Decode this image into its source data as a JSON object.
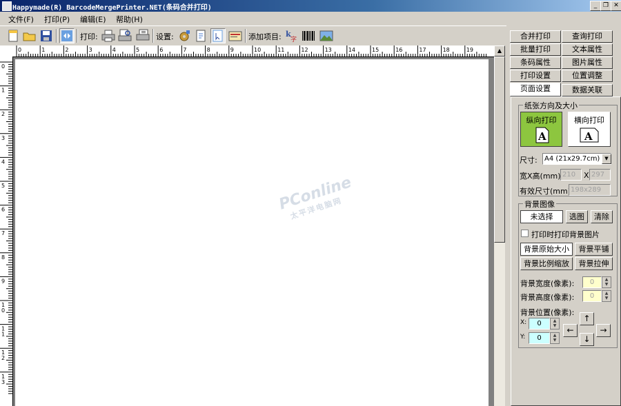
{
  "window": {
    "title": "Happymade(R) BarcodeMergePrinter.NET(条码合并打印)"
  },
  "menu": [
    "文件(F)",
    "打印(P)",
    "编辑(E)",
    "帮助(H)"
  ],
  "toolbar": {
    "print_label": "打印:",
    "settings_label": "设置:",
    "add_label": "添加项目:"
  },
  "ruler": {
    "h_ticks": [
      "0",
      "1",
      "2",
      "3",
      "4",
      "5",
      "6",
      "7",
      "8",
      "9",
      "10",
      "11",
      "12",
      "13",
      "14",
      "15",
      "16",
      "17",
      "18",
      "19"
    ],
    "v_ticks": [
      "0",
      "1",
      "2",
      "3",
      "4",
      "5",
      "6",
      "7",
      "8",
      "9",
      "1 0",
      "1 1",
      "1 2",
      "1 3"
    ]
  },
  "watermark": {
    "brand": "PConline",
    "sub": "太平洋电脑网"
  },
  "tabs": [
    "合并打印",
    "查询打印",
    "批量打印",
    "文本属性",
    "条码属性",
    "图片属性",
    "打印设置",
    "位置调整",
    "页面设置",
    "数据关联"
  ],
  "active_tab": "页面设置",
  "page_setup": {
    "group_title": "纸张方向及大小",
    "portrait": "纵向打印",
    "landscape": "横向打印",
    "size_label": "尺寸:",
    "size_value": "A4 (21x29.7cm)",
    "wh_label": "宽X高(mm):",
    "width": "210",
    "x_sep": "X",
    "height": "297",
    "effective_label": "有效尺寸(mm):",
    "effective_value": "198x289"
  },
  "background": {
    "group_title": "背景图像",
    "unselected": "未选择",
    "select_btn": "选图",
    "clear_btn": "清除",
    "print_bg_check": "打印时打印背景图片",
    "original_size": "背景原始大小",
    "tile": "背景平铺",
    "scale": "背景比例缩放",
    "stretch": "背景拉伸",
    "width_label": "背景宽度(像素):",
    "width_value": "0",
    "height_label": "背景高度(像素):",
    "height_value": "0",
    "pos_label": "背景位置(像素):",
    "x_label": "X:",
    "x_value": "0",
    "y_label": "Y:",
    "y_value": "0"
  },
  "icons": [
    "new-file-icon",
    "open-folder-icon",
    "save-icon",
    "design-mode-icon",
    "print-icon",
    "print-preview-icon",
    "print-setup-icon",
    "gear-icon",
    "page-setup-icon",
    "pointer-icon",
    "card-settings-icon",
    "add-text-icon",
    "add-barcode-icon",
    "add-image-icon"
  ]
}
